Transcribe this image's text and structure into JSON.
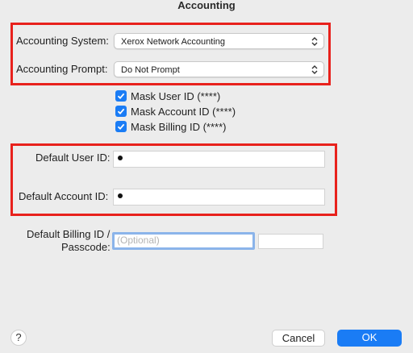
{
  "window": {
    "title": "Accounting"
  },
  "accounting_system": {
    "label": "Accounting System:",
    "value": "Xerox Network Accounting"
  },
  "accounting_prompt": {
    "label": "Accounting Prompt:",
    "value": "Do Not Prompt"
  },
  "masks": [
    {
      "label": "Mask User ID (****)",
      "checked": true
    },
    {
      "label": "Mask Account ID (****)",
      "checked": true
    },
    {
      "label": "Mask Billing ID (****)",
      "checked": true
    }
  ],
  "default_user_id": {
    "label": "Default User ID:",
    "value": "•"
  },
  "default_account_id": {
    "label": "Default Account ID:",
    "value": "•"
  },
  "default_billing_id": {
    "label_line1": "Default Billing ID /",
    "label_line2": "Passcode:",
    "placeholder": "(Optional)",
    "second_value": ""
  },
  "buttons": {
    "help": "?",
    "cancel": "Cancel",
    "ok": "OK"
  },
  "colors": {
    "accent": "#1a7cf5",
    "highlight_box": "#e8211c",
    "background": "#ececec"
  },
  "icons": {
    "select_chevron": "chevron-up-down-icon",
    "checkbox": "checkmark-icon"
  }
}
